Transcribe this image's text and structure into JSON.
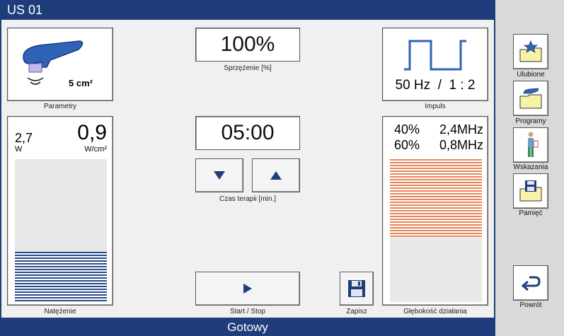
{
  "window": {
    "title": "US 01"
  },
  "status": {
    "text": "Gotowy"
  },
  "parametry": {
    "area": "5 cm²",
    "caption": "Parametry"
  },
  "sprzezenie": {
    "value": "100%",
    "caption": "Sprzężenie [%]"
  },
  "impuls": {
    "value": "50 Hz  /  1 : 2",
    "caption": "Impuls"
  },
  "natezenie": {
    "power_value": "2,7",
    "power_unit": "W",
    "density_value": "0,9",
    "density_unit": "W/cm²",
    "level_fraction": 0.35,
    "caption": "Natężenie"
  },
  "timer": {
    "value": "05:00",
    "caption": "Czas terapii [min.]"
  },
  "start": {
    "caption": "Start / Stop"
  },
  "save": {
    "caption": "Zapisz"
  },
  "depth": {
    "row1_pct": "40%",
    "row1_freq": "2,4MHz",
    "row2_pct": "60%",
    "row2_freq": "0,8MHz",
    "level_fraction": 0.55,
    "caption": "Głębokość działania"
  },
  "sidebar": {
    "items": [
      {
        "label": "Ulubione",
        "icon": "star-folder-icon"
      },
      {
        "label": "Programy",
        "icon": "programs-folder-icon"
      },
      {
        "label": "Wskazania",
        "icon": "body-figure-icon"
      },
      {
        "label": "Pamięć",
        "icon": "floppy-folder-icon"
      },
      {
        "label": "Powrót",
        "icon": "return-arrow-icon"
      }
    ]
  },
  "colors": {
    "header": "#1f3d7a",
    "intensity": "#2a4a8a",
    "depth": "#e8845a"
  }
}
